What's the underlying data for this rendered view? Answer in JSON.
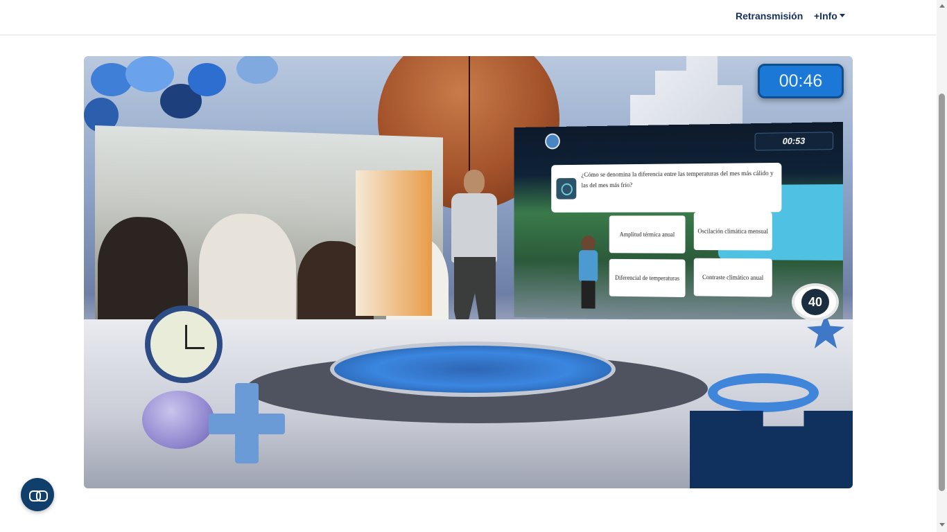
{
  "nav": {
    "retransmision_label": "Retransmisión",
    "info_label": "+Info"
  },
  "video": {
    "countdown": "00:46",
    "quiz": {
      "timer": "00:53",
      "question": "¿Cómo se denomina la diferencia entre las temperaturas del mes más cálido y las del mes más frío?",
      "answers": [
        "Amplitud térmica anual",
        "Oscilación climática mensual",
        "Diferencial de temperaturas",
        "Contraste climático anual"
      ],
      "score": "40"
    }
  },
  "colors": {
    "nav_text": "#15315b",
    "timer_bg": "#1c78d6",
    "fab_bg": "#113f6b"
  },
  "icons": {
    "fab": "link-icon",
    "dropdown": "caret-down-icon"
  }
}
